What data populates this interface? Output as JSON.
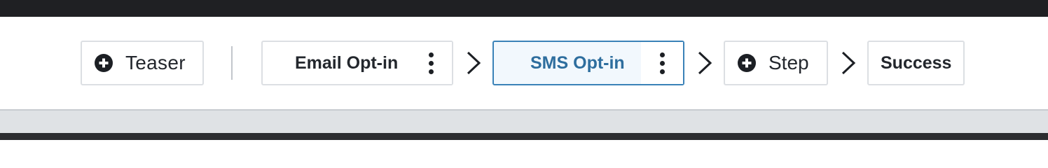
{
  "funnel": {
    "steps": [
      {
        "label": "Teaser"
      },
      {
        "label": "Email Opt-in"
      },
      {
        "label": "SMS Opt-in"
      },
      {
        "label": "Step"
      },
      {
        "label": "Success"
      }
    ]
  },
  "colors": {
    "active_border": "#3a82b8",
    "active_text": "#2e6e9e",
    "active_bg": "#f2f8fd",
    "top_bar": "#1f2023"
  },
  "icons": [
    "plus-circle-icon",
    "vertical-ellipsis-icon",
    "chevron-right-icon"
  ]
}
